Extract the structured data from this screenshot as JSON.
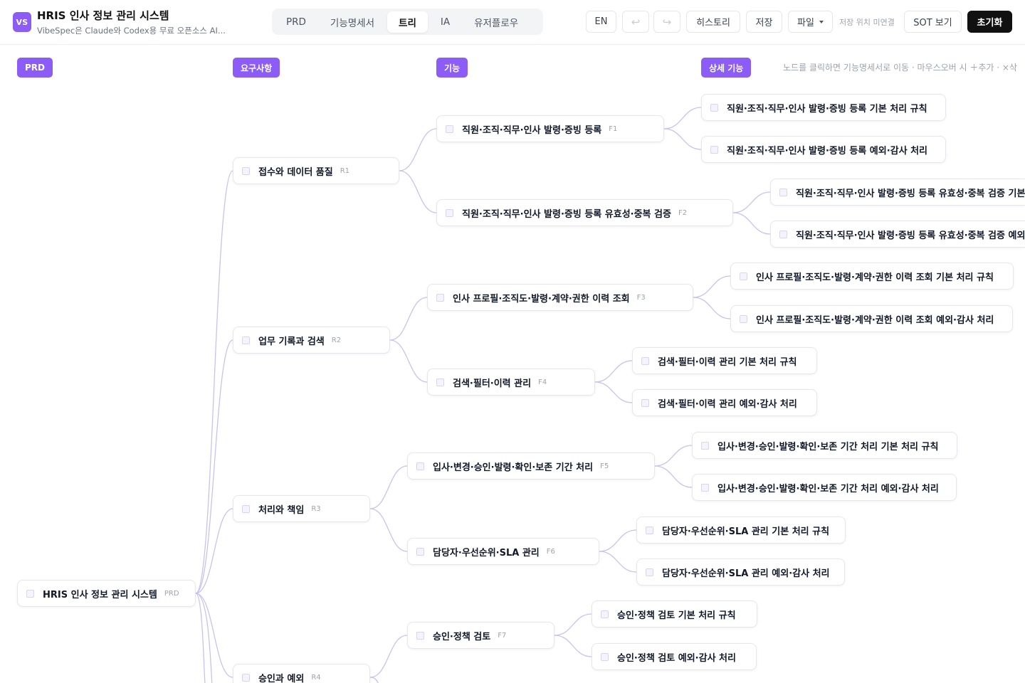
{
  "header": {
    "logo": "VS",
    "title": "HRIS 인사 정보 관리 시스템",
    "subtitle": "VibeSpec은 Claude와 Codex용 무료 오픈소스 AI...",
    "tabs": [
      "PRD",
      "기능명세서",
      "트리",
      "IA",
      "유저플로우"
    ],
    "active_tab": "트리",
    "lang_button": "EN",
    "undo_icon": "↩",
    "redo_icon": "↪",
    "history_button": "히스토리",
    "save_button": "저장",
    "file_button": "파일",
    "save_location": "저장 위치 미연결",
    "sot_button": "SOT 보기",
    "reset_button": "초기화"
  },
  "columns": {
    "prd": "PRD",
    "requirements": "요구사항",
    "features": "기능",
    "details": "상세 기능",
    "hint": "노드를 클릭하면 기능명세서로 이동 · 마우스오버 시 ＋추가 · ×삭"
  },
  "colors": {
    "accent": "#8b5cf6",
    "link": "#c9c2ef"
  },
  "tree": {
    "root": {
      "label": "HRIS 인사 정보 관리 시스템",
      "tag": "PRD"
    },
    "requirements": [
      {
        "label": "접수와 데이터 품질",
        "tag": "R1"
      },
      {
        "label": "업무 기록과 검색",
        "tag": "R2"
      },
      {
        "label": "처리와 책임",
        "tag": "R3"
      },
      {
        "label": "승인과 예외",
        "tag": "R4"
      }
    ],
    "features": [
      {
        "label": "직원·조직·직무·인사 발령·증빙 등록",
        "tag": "F1"
      },
      {
        "label": "직원·조직·직무·인사 발령·증빙 등록 유효성·중복 검증",
        "tag": "F2"
      },
      {
        "label": "인사 프로필·조직도·발령·계약·권한 이력 조회",
        "tag": "F3"
      },
      {
        "label": "검색·필터·이력 관리",
        "tag": "F4"
      },
      {
        "label": "입사·변경·승인·발령·확인·보존 기간 처리",
        "tag": "F5"
      },
      {
        "label": "담당자·우선순위·SLA 관리",
        "tag": "F6"
      },
      {
        "label": "승인·정책 검토",
        "tag": "F7"
      }
    ],
    "details": [
      {
        "label": "직원·조직·직무·인사 발령·증빙 등록 기본 처리 규칙"
      },
      {
        "label": "직원·조직·직무·인사 발령·증빙 등록 예외·감사 처리"
      },
      {
        "label": "직원·조직·직무·인사 발령·증빙 등록 유효성·중복 검증 기본"
      },
      {
        "label": "직원·조직·직무·인사 발령·증빙 등록 유효성·중복 검증 예외·"
      },
      {
        "label": "인사 프로필·조직도·발령·계약·권한 이력 조회 기본 처리 규칙"
      },
      {
        "label": "인사 프로필·조직도·발령·계약·권한 이력 조회 예외·감사 처리"
      },
      {
        "label": "검색·필터·이력 관리 기본 처리 규칙"
      },
      {
        "label": "검색·필터·이력 관리 예외·감사 처리"
      },
      {
        "label": "입사·변경·승인·발령·확인·보존 기간 처리 기본 처리 규칙"
      },
      {
        "label": "입사·변경·승인·발령·확인·보존 기간 처리 예외·감사 처리"
      },
      {
        "label": "담당자·우선순위·SLA 관리 기본 처리 규칙"
      },
      {
        "label": "담당자·우선순위·SLA 관리 예외·감사 처리"
      },
      {
        "label": "승인·정책 검토 기본 처리 규칙"
      },
      {
        "label": "승인·정책 검토 예외·감사 처리"
      }
    ]
  }
}
